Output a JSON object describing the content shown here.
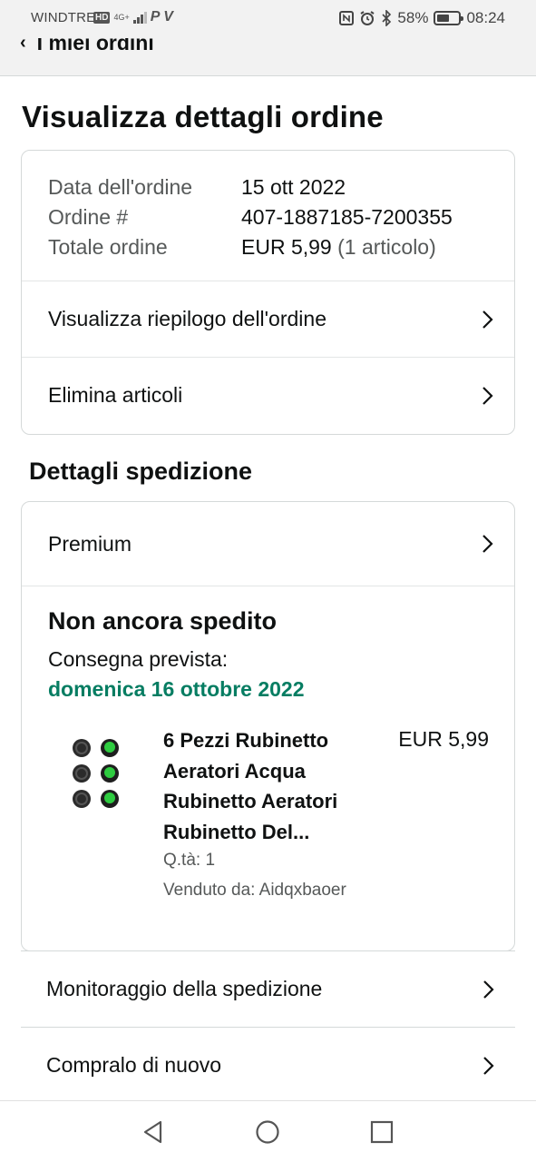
{
  "status_bar": {
    "carrier": "WINDTRE",
    "hd_badge": "HD",
    "network": "4G+",
    "extra_icons": "P V",
    "battery_percent": "58%",
    "battery_level": 0.58,
    "time": "08:24"
  },
  "header": {
    "back_label": "I miei ordini"
  },
  "page": {
    "title": "Visualizza dettagli ordine"
  },
  "order_summary": {
    "rows": [
      {
        "label": "Data dell'ordine",
        "value": "15 ott 2022"
      },
      {
        "label": "Ordine #",
        "value": "407-1887185-7200355"
      },
      {
        "label": "Totale ordine",
        "value": "EUR 5,99",
        "extra": "(1 articolo)"
      }
    ],
    "links": [
      {
        "label": "Visualizza riepilogo dell'ordine"
      },
      {
        "label": "Elimina articoli"
      }
    ]
  },
  "shipping": {
    "section_title": "Dettagli spedizione",
    "service": "Premium",
    "status": "Non ancora spedito",
    "delivery_label": "Consegna prevista:",
    "delivery_date": "domenica 16 ottobre 2022",
    "item": {
      "title": "6 Pezzi Rubinetto Aeratori Acqua Rubinetto Aeratori Rubinetto Del...",
      "price": "EUR 5,99",
      "quantity": "Q.tà: 1",
      "seller": "Venduto da: Aidqxbaoer"
    }
  },
  "actions": [
    {
      "label": "Monitoraggio della spedizione"
    },
    {
      "label": "Compralo di nuovo"
    }
  ],
  "colors": {
    "delivery_green": "#067d62",
    "muted_text": "#565959",
    "border": "#d5d9d9",
    "header_bg": "#f2f2f2"
  }
}
